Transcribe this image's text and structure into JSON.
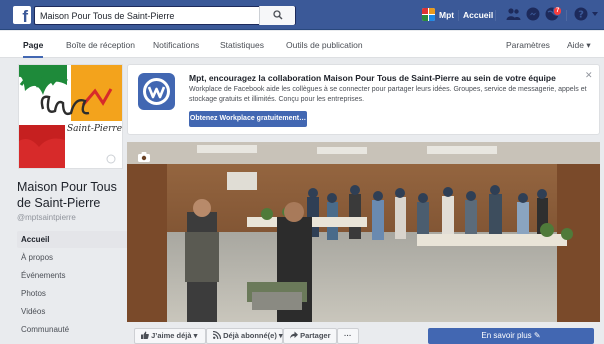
{
  "topbar": {
    "search_value": "Maison Pour Tous de Saint-Pierre",
    "user_name": "Mpt",
    "home_label": "Accueil",
    "notif_count": "7"
  },
  "tabs": {
    "items": [
      "Page",
      "Boîte de réception",
      "Notifications",
      "Statistiques",
      "Outils de publication"
    ],
    "settings": "Paramètres",
    "help": "Aide ▾"
  },
  "sidebar": {
    "page_name": "Maison Pour Tous de Saint-Pierre",
    "handle": "@mptsaintpierre",
    "nav": [
      "Accueil",
      "À propos",
      "Événements",
      "Photos",
      "Vidéos",
      "Communauté"
    ]
  },
  "promo": {
    "title": "Mpt, encouragez la collaboration Maison Pour Tous de Saint-Pierre au sein de votre équipe",
    "description": "Workplace de Facebook aide les collègues à se connecter pour partager leurs idées. Groupes, service de messagerie, appels et stockage gratuits et illimités. Conçu pour les entreprises.",
    "button": "Obtenez Workplace gratuitement…"
  },
  "actions": {
    "like": "J’aime déjà ▾",
    "follow": "Déjà abonné(e) ▾",
    "share": "Partager",
    "more": "···",
    "learn_more": "En savoir plus ✎"
  },
  "colors": {
    "brand": "#3b5998",
    "button_blue": "#4267b2"
  }
}
